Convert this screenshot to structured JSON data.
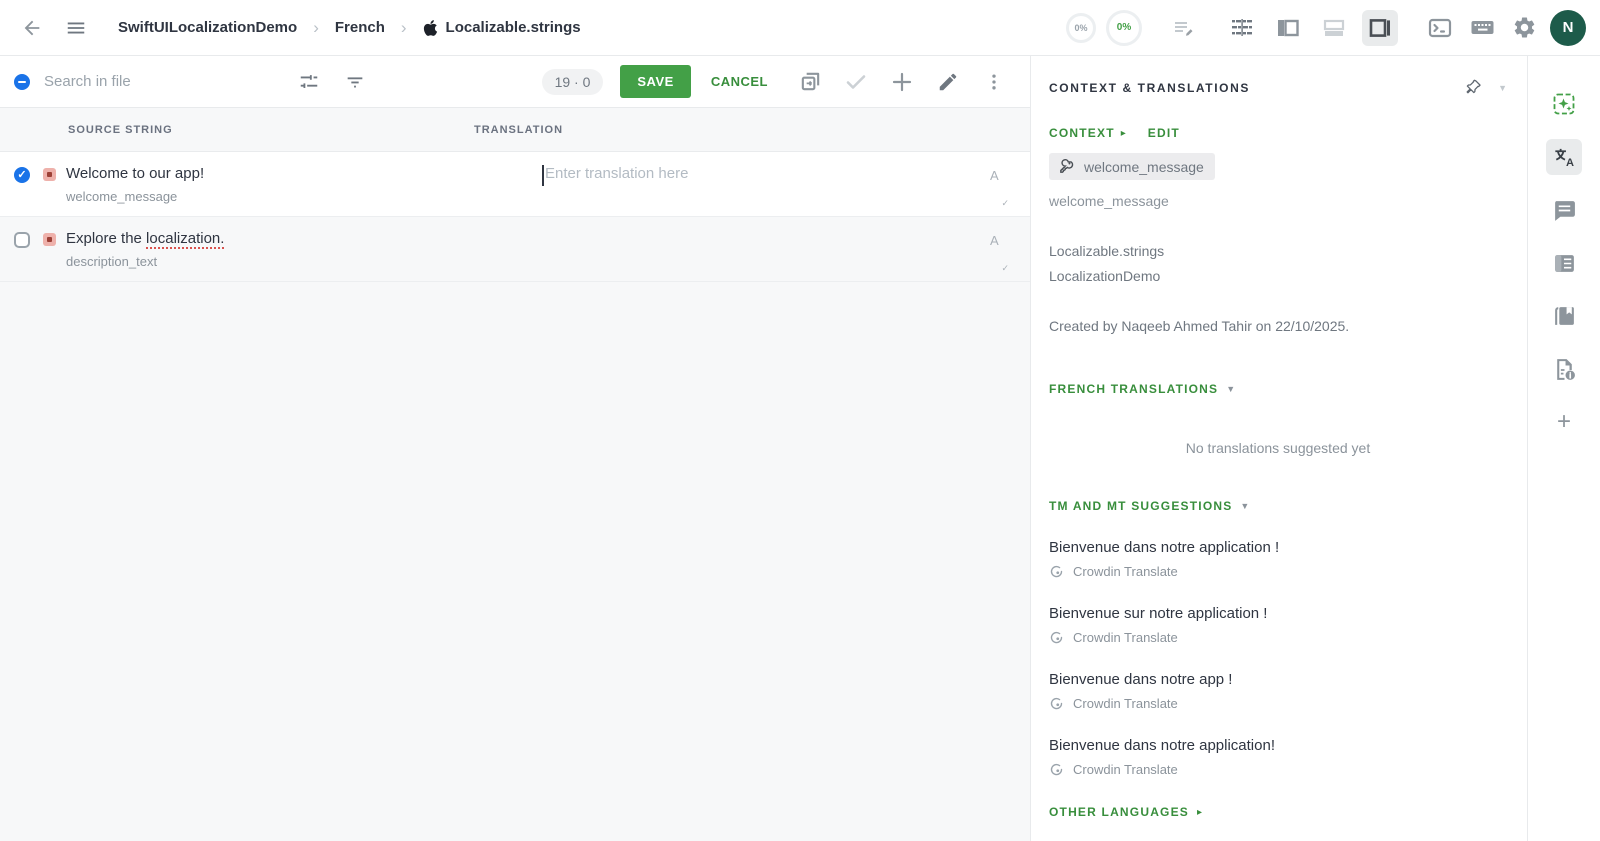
{
  "topbar": {
    "breadcrumb": {
      "project": "SwiftUILocalizationDemo",
      "language": "French",
      "file": "Localizable.strings"
    },
    "progress_translated": "0%",
    "progress_approved": "0%",
    "avatar_initial": "N"
  },
  "toolbar": {
    "search_placeholder": "Search in file",
    "counter": "19 · 0",
    "save_label": "SAVE",
    "cancel_label": "CANCEL"
  },
  "table": {
    "col_source": "SOURCE STRING",
    "col_translation": "TRANSLATION",
    "rows": [
      {
        "source": "Welcome to our app!",
        "key": "welcome_message",
        "translation_placeholder": "Enter translation here"
      },
      {
        "source_prefix": "Explore the ",
        "source_flagged": "localization.",
        "key": "description_text"
      }
    ],
    "spell_letter": "A",
    "spell_tick": "✓"
  },
  "context_panel": {
    "title": "CONTEXT & TRANSLATIONS",
    "context_label": "CONTEXT",
    "context_arrow": "▸",
    "edit_label": "EDIT",
    "key_chip": "welcome_message",
    "key_name": "welcome_message",
    "file_name": "Localizable.strings",
    "project_name": "LocalizationDemo",
    "created_line": "Created by Naqeeb Ahmed Tahir on 22/10/2025.",
    "french_header": "FRENCH TRANSLATIONS",
    "dropdown_caret": "▼",
    "no_translations": "No translations suggested yet",
    "tm_header": "TM AND MT SUGGESTIONS",
    "suggestions": [
      {
        "text": "Bienvenue dans notre application !",
        "source": "Crowdin Translate"
      },
      {
        "text": "Bienvenue sur notre application !",
        "source": "Crowdin Translate"
      },
      {
        "text": "Bienvenue dans notre app !",
        "source": "Crowdin Translate"
      },
      {
        "text": "Bienvenue dans notre application!",
        "source": "Crowdin Translate"
      }
    ],
    "other_languages": "OTHER LANGUAGES",
    "other_arrow": "▸"
  },
  "colors": {
    "accent_green": "#43a047",
    "link_green": "#388e3c",
    "checkbox_blue": "#1a73e8",
    "avatar_green": "#1d5b4a",
    "status_red_bg": "#eeb1ab",
    "status_red_dot": "#9c4036"
  }
}
